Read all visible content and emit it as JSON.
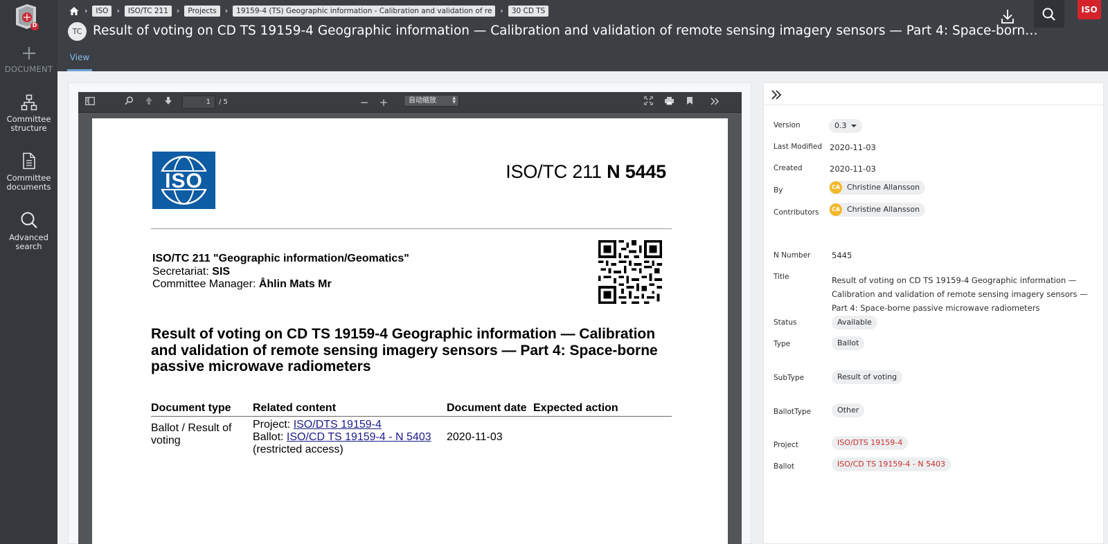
{
  "app": {
    "logo_badge": "D"
  },
  "rail": {
    "add_label": "DOCUMENT",
    "items": [
      {
        "label_1": "Committee",
        "label_2": "structure"
      },
      {
        "label_1": "Committee",
        "label_2": "documents"
      },
      {
        "label_1": "Advanced",
        "label_2": "search"
      }
    ]
  },
  "breadcrumbs": [
    "ISO",
    "ISO/TC 211",
    "Projects",
    "19159-4 (TS) Geographic information - Calibration and validation of re",
    "30 CD TS"
  ],
  "header": {
    "badge": "TC",
    "title": "Result of voting on CD TS 19159-4 Geographic information — Calibration and validation of remote sensing imagery sensors — Part 4: Space-borne passive microwave radiometers",
    "iso_mark": "ISO"
  },
  "tabs": [
    {
      "label": "View"
    }
  ],
  "pdf_viewer": {
    "page_current": "1",
    "page_total": "/ 5",
    "zoom": "自动缩放",
    "page": {
      "logo_text": "ISO",
      "doc_prefix": "ISO/TC 211 ",
      "doc_number": "N 5445",
      "committee_line": "ISO/TC 211 \"Geographic information/Geomatics\"",
      "secretariat_label": "Secretariat: ",
      "secretariat_value": "SIS",
      "manager_label": "Committee Manager: ",
      "manager_value": "Åhlin Mats Mr",
      "title": "Result of voting on CD TS 19159-4 Geographic information — Calibration and validation of remote sensing imagery sensors — Part 4: Space-borne passive microwave radiometers",
      "table": {
        "headers": [
          "Document type",
          "Related content",
          "Document date",
          "Expected action"
        ],
        "doc_type": "Ballot / Result of voting",
        "project_label": "Project: ",
        "project_link": "ISO/DTS 19159-4",
        "ballot_label": "Ballot: ",
        "ballot_link": "ISO/CD TS 19159-4 - N 5403",
        "restricted": "(restricted access)",
        "doc_date": "2020-11-03",
        "expected_action": ""
      }
    }
  },
  "metadata": {
    "version_label": "Version",
    "version_value": "0.3",
    "last_modified_label": "Last Modified",
    "last_modified_value": "2020-11-03",
    "created_label": "Created",
    "created_value": "2020-11-03",
    "by_label": "By",
    "by_initials": "CA",
    "by_value": "Christine Allansson",
    "contributors_label": "Contributors",
    "contributors_initials": "CA",
    "contributors_value": "Christine Allansson",
    "n_number_label": "N Number",
    "n_number_value": "5445",
    "title_label": "Title",
    "title_value": "Result of voting on CD TS 19159-4 Geographic information — Calibration and validation of remote sensing imagery sensors — Part 4: Space-borne passive microwave radiometers",
    "status_label": "Status",
    "status_value": "Available",
    "type_label": "Type",
    "type_value": "Ballot",
    "subtype_label": "SubType",
    "subtype_value": "Result of voting",
    "ballottype_label": "BallotType",
    "ballottype_value": "Other",
    "project_label": "Project",
    "project_value": "ISO/DTS 19159-4",
    "ballot_label": "Ballot",
    "ballot_value": "ISO/CD TS 19159-4 - N 5403"
  },
  "colors": {
    "sidebar": "#35393e",
    "header": "#3c4045",
    "tab_accent": "#6fa3d8",
    "iso_blue": "#0e5ca3",
    "iso_red": "#d5232b",
    "link_red": "#c9302c",
    "avatar": "#f3b82a"
  }
}
